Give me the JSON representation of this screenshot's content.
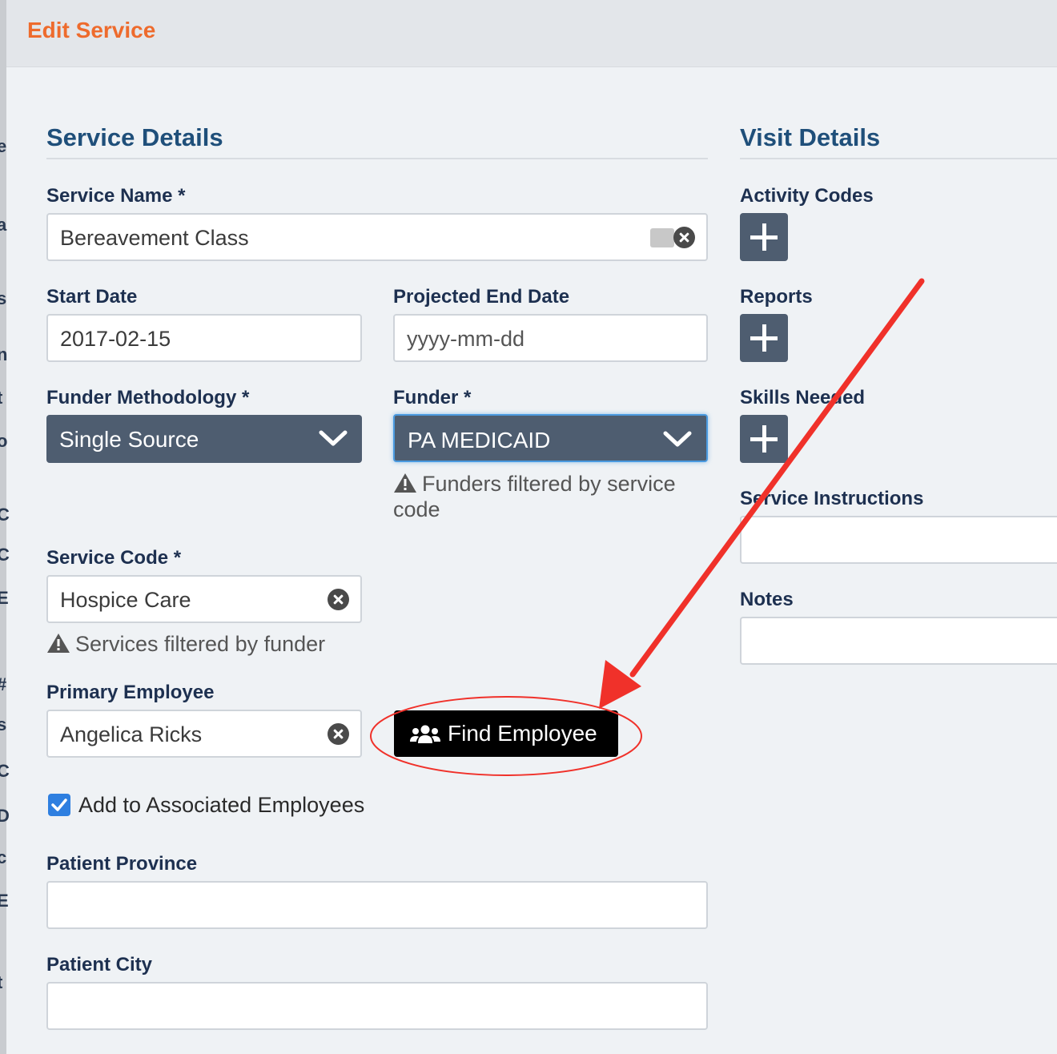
{
  "modal": {
    "title": "Edit Service"
  },
  "service_details": {
    "heading": "Service Details",
    "service_name": {
      "label": "Service Name *",
      "value": "Bereavement Class"
    },
    "start_date": {
      "label": "Start Date",
      "value": "2017-02-15"
    },
    "projected_end_date": {
      "label": "Projected End Date",
      "placeholder": "yyyy-mm-dd"
    },
    "funder_methodology": {
      "label": "Funder Methodology *",
      "value": "Single Source"
    },
    "funder": {
      "label": "Funder *",
      "value": "PA MEDICAID",
      "hint": "Funders filtered by service code"
    },
    "service_code": {
      "label": "Service Code *",
      "value": "Hospice Care",
      "hint": "Services filtered by funder"
    },
    "primary_employee": {
      "label": "Primary Employee",
      "value": "Angelica Ricks",
      "find_button": "Find Employee"
    },
    "add_associated": {
      "label": "Add to Associated Employees",
      "checked": true
    },
    "patient_province": {
      "label": "Patient Province",
      "value": ""
    },
    "patient_city": {
      "label": "Patient City",
      "value": ""
    }
  },
  "visit_details": {
    "heading": "Visit Details",
    "activity_codes": {
      "label": "Activity Codes"
    },
    "reports": {
      "label": "Reports"
    },
    "skills_needed": {
      "label": "Skills Needed"
    },
    "service_instructions": {
      "label": "Service Instructions",
      "value": ""
    },
    "notes": {
      "label": "Notes",
      "value": ""
    }
  },
  "colors": {
    "title": "#ee6b2d",
    "heading": "#1f4f7a",
    "select_bg": "#4e5d70",
    "annotation": "#f0312a",
    "checkbox": "#2e7fe0"
  },
  "left_strip_chars": [
    "e",
    "a",
    "s",
    "n",
    "t",
    "o",
    "C",
    "C",
    "E",
    "#",
    "s",
    "C",
    "D",
    "c",
    "E",
    "t"
  ]
}
